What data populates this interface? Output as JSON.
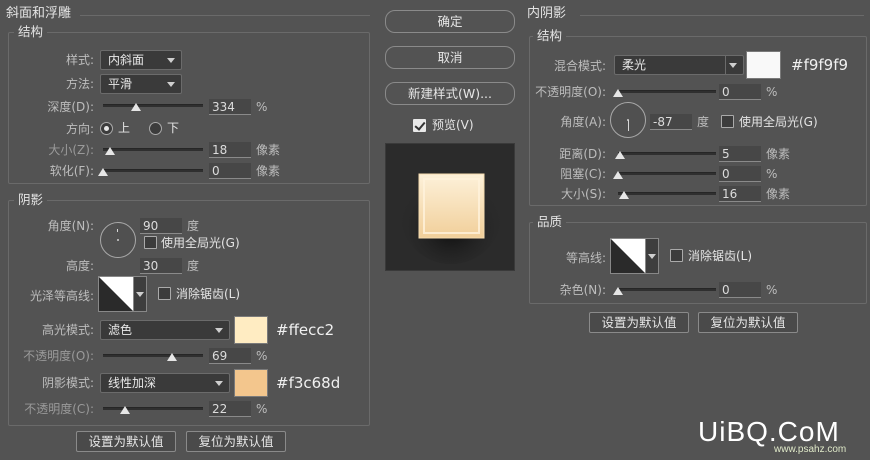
{
  "left": {
    "section_title": "斜面和浮雕",
    "structure": {
      "title": "结构",
      "style_label": "样式:",
      "style_value": "内斜面",
      "technique_label": "方法:",
      "technique_value": "平滑",
      "depth_label": "深度(D):",
      "depth_value": "334",
      "depth_unit": "%",
      "depth_fraction": 0.33,
      "direction_label": "方向:",
      "direction_up": "上",
      "direction_down": "下",
      "direction_selected": "up",
      "size_label": "大小(Z):",
      "size_value": "18",
      "size_unit": "像素",
      "size_fraction": 0.07,
      "soften_label": "软化(F):",
      "soften_value": "0",
      "soften_unit": "像素",
      "soften_fraction": 0.0
    },
    "shading": {
      "title": "阴影",
      "angle_label": "角度(N):",
      "angle_value": "90",
      "angle_unit": "度",
      "global_light_label": "使用全局光(G)",
      "global_light_checked": false,
      "altitude_label": "高度:",
      "altitude_value": "30",
      "altitude_unit": "度",
      "gloss_contour_label": "光泽等高线:",
      "antialias_label": "消除锯齿(L)",
      "antialias_checked": false,
      "highlight_mode_label": "高光模式:",
      "highlight_mode_value": "滤色",
      "highlight_color": "#ffecc2",
      "highlight_hex": "#ffecc2",
      "highlight_opacity_label": "不透明度(O):",
      "highlight_opacity_value": "69",
      "highlight_opacity_unit": "%",
      "highlight_opacity_fraction": 0.69,
      "shadow_mode_label": "阴影模式:",
      "shadow_mode_value": "线性加深",
      "shadow_color": "#f3c68d",
      "shadow_hex": "#f3c68d",
      "shadow_opacity_label": "不透明度(C):",
      "shadow_opacity_value": "22",
      "shadow_opacity_unit": "%",
      "shadow_opacity_fraction": 0.22
    },
    "set_default": "设置为默认值",
    "reset_default": "复位为默认值"
  },
  "middle": {
    "ok": "确定",
    "cancel": "取消",
    "new_style": "新建样式(W)...",
    "preview_label": "预览(V)",
    "preview_checked": true
  },
  "right": {
    "section_title": "内阴影",
    "structure": {
      "title": "结构",
      "blend_mode_label": "混合模式:",
      "blend_mode_value": "柔光",
      "color": "#f9f9f9",
      "hex": "#f9f9f9",
      "opacity_label": "不透明度(O):",
      "opacity_value": "0",
      "opacity_unit": "%",
      "opacity_fraction": 0.0,
      "angle_label": "角度(A):",
      "angle_value": "-87",
      "angle_unit": "度",
      "global_light_label": "使用全局光(G)",
      "global_light_checked": false,
      "distance_label": "距离(D):",
      "distance_value": "5",
      "distance_unit": "像素",
      "distance_fraction": 0.02,
      "choke_label": "阻塞(C):",
      "choke_value": "0",
      "choke_unit": "%",
      "choke_fraction": 0.0,
      "size_label": "大小(S):",
      "size_value": "16",
      "size_unit": "像素",
      "size_fraction": 0.06
    },
    "quality": {
      "title": "品质",
      "contour_label": "等高线:",
      "antialias_label": "消除锯齿(L)",
      "antialias_checked": false,
      "noise_label": "杂色(N):",
      "noise_value": "0",
      "noise_unit": "%",
      "noise_fraction": 0.0
    },
    "set_default": "设置为默认值",
    "reset_default": "复位为默认值"
  },
  "watermark": {
    "text": "UiBQ.CoM",
    "sub": "www.psahz.com"
  }
}
